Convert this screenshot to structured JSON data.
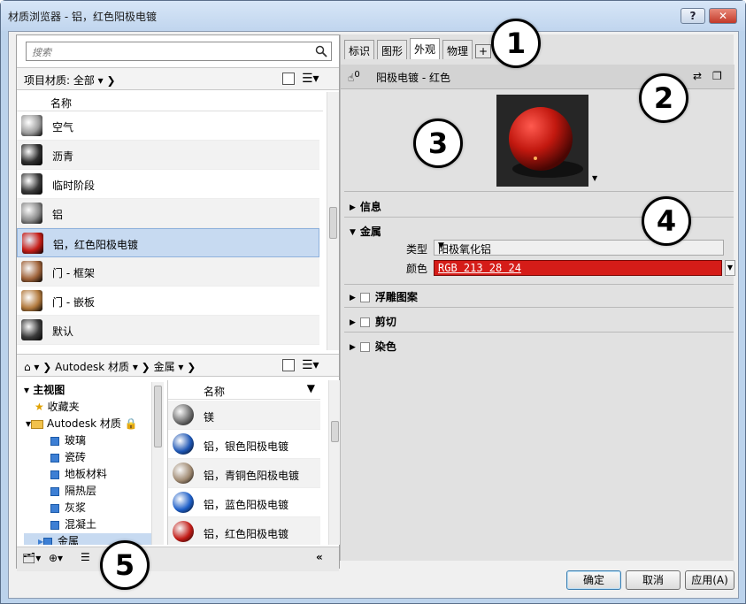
{
  "window": {
    "title": "材质浏览器 - 铝，红色阳极电镀",
    "help_label": "?",
    "close_label": "✕"
  },
  "search": {
    "placeholder": "搜索"
  },
  "project_bar": {
    "label": "项目材质: 全部"
  },
  "list_header": {
    "name_col": "名称"
  },
  "project_materials": [
    {
      "label": "空气",
      "color": "#9c9c9c"
    },
    {
      "label": "沥青",
      "color": "#2e2e2e"
    },
    {
      "label": "临时阶段",
      "color": "#3a3a3a"
    },
    {
      "label": "铝",
      "color": "#8a8a8a"
    },
    {
      "label": "铝，红色阳极电镀",
      "color": "#c61e18",
      "selected": true
    },
    {
      "label": "门 - 框架",
      "color": "#a0643b"
    },
    {
      "label": "门 - 嵌板",
      "color": "#b27a3e"
    },
    {
      "label": "默认",
      "color": "#3b3b3b"
    }
  ],
  "library_bar": {
    "crumb1": "Autodesk 材质",
    "crumb2": "金属"
  },
  "tree": {
    "root": "主视图",
    "favorites": "收藏夹",
    "library": "Autodesk 材质",
    "items": [
      "玻璃",
      "瓷砖",
      "地板材料",
      "隔热层",
      "灰浆",
      "混凝土",
      "金属"
    ]
  },
  "library_list": {
    "header": "名称",
    "items": [
      {
        "label": "镁",
        "color": "#6e6e6e"
      },
      {
        "label": "铝，银色阳极电镀",
        "color": "#1e56b4"
      },
      {
        "label": "铝，青铜色阳极电镀",
        "color": "#a08a72"
      },
      {
        "label": "铝，蓝色阳极电镀",
        "color": "#1e5fc8"
      },
      {
        "label": "铝，红色阳极电镀",
        "color": "#c21c17"
      }
    ]
  },
  "tabs": [
    "标识",
    "图形",
    "外观",
    "物理",
    "+"
  ],
  "active_tab": "外观",
  "asset": {
    "count": "0",
    "name": "阳极电镀 - 红色"
  },
  "sections": {
    "info": "信息",
    "metal": "金属",
    "type_label": "类型",
    "type_value": "阳极氧化铝",
    "color_label": "颜色",
    "color_value": "RGB 213 28 24",
    "relief": "浮雕图案",
    "cutout": "剪切",
    "tint": "染色"
  },
  "footer": {
    "ok": "确定",
    "cancel": "取消",
    "apply": "应用(A)"
  },
  "callouts": [
    "1",
    "2",
    "3",
    "4",
    "5"
  ],
  "colors": {
    "accent": "#d51c18",
    "selection": "#c7daf1",
    "chrome": "#bcd3ec"
  }
}
